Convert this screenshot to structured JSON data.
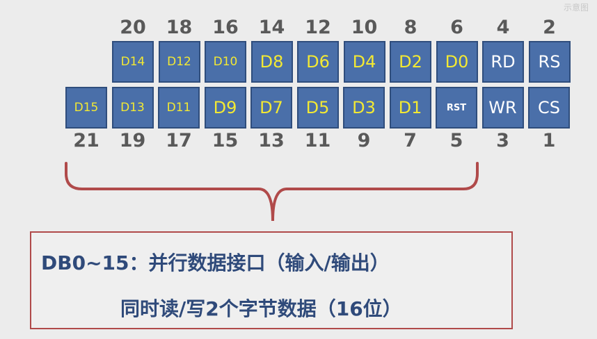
{
  "watermark": "示意图",
  "top_numbers": [
    "20",
    "18",
    "16",
    "14",
    "12",
    "10",
    "8",
    "6",
    "4",
    "2"
  ],
  "bottom_numbers": [
    "21",
    "19",
    "17",
    "15",
    "13",
    "11",
    "9",
    "7",
    "5",
    "3",
    "1"
  ],
  "top_pins": [
    "D14",
    "D12",
    "D10",
    "D8",
    "D6",
    "D4",
    "D2",
    "D0",
    "RD",
    "RS"
  ],
  "bottom_pins": [
    "D15",
    "D13",
    "D11",
    "D9",
    "D7",
    "D5",
    "D3",
    "D1",
    "RST",
    "WR",
    "CS"
  ],
  "colors": {
    "pin_fill": "#4a6fa9",
    "pin_border": "#2f4d7c",
    "data_text": "#f3e933",
    "control_text": "#ffffff",
    "brace": "#b04a4a",
    "desc_text": "#2f4a7a"
  },
  "description": {
    "line1": "DB0~15：并行数据接口（输入/输出）",
    "line2": "同时读/写2个字节数据（16位）"
  }
}
